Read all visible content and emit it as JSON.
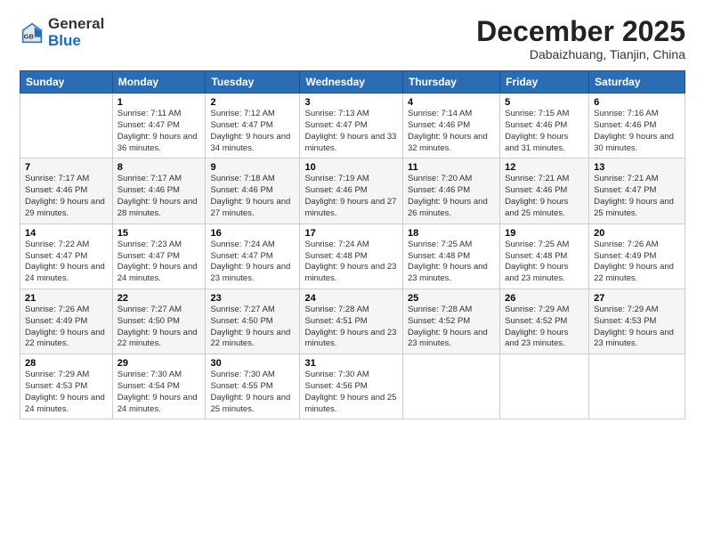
{
  "logo": {
    "text_general": "General",
    "text_blue": "Blue"
  },
  "title": "December 2025",
  "subtitle": "Dabaizhuang, Tianjin, China",
  "days_of_week": [
    "Sunday",
    "Monday",
    "Tuesday",
    "Wednesday",
    "Thursday",
    "Friday",
    "Saturday"
  ],
  "weeks": [
    [
      {
        "day": "",
        "sunrise": "",
        "sunset": "",
        "daylight": ""
      },
      {
        "day": "1",
        "sunrise": "Sunrise: 7:11 AM",
        "sunset": "Sunset: 4:47 PM",
        "daylight": "Daylight: 9 hours and 36 minutes."
      },
      {
        "day": "2",
        "sunrise": "Sunrise: 7:12 AM",
        "sunset": "Sunset: 4:47 PM",
        "daylight": "Daylight: 9 hours and 34 minutes."
      },
      {
        "day": "3",
        "sunrise": "Sunrise: 7:13 AM",
        "sunset": "Sunset: 4:47 PM",
        "daylight": "Daylight: 9 hours and 33 minutes."
      },
      {
        "day": "4",
        "sunrise": "Sunrise: 7:14 AM",
        "sunset": "Sunset: 4:46 PM",
        "daylight": "Daylight: 9 hours and 32 minutes."
      },
      {
        "day": "5",
        "sunrise": "Sunrise: 7:15 AM",
        "sunset": "Sunset: 4:46 PM",
        "daylight": "Daylight: 9 hours and 31 minutes."
      },
      {
        "day": "6",
        "sunrise": "Sunrise: 7:16 AM",
        "sunset": "Sunset: 4:46 PM",
        "daylight": "Daylight: 9 hours and 30 minutes."
      }
    ],
    [
      {
        "day": "7",
        "sunrise": "Sunrise: 7:17 AM",
        "sunset": "Sunset: 4:46 PM",
        "daylight": "Daylight: 9 hours and 29 minutes."
      },
      {
        "day": "8",
        "sunrise": "Sunrise: 7:17 AM",
        "sunset": "Sunset: 4:46 PM",
        "daylight": "Daylight: 9 hours and 28 minutes."
      },
      {
        "day": "9",
        "sunrise": "Sunrise: 7:18 AM",
        "sunset": "Sunset: 4:46 PM",
        "daylight": "Daylight: 9 hours and 27 minutes."
      },
      {
        "day": "10",
        "sunrise": "Sunrise: 7:19 AM",
        "sunset": "Sunset: 4:46 PM",
        "daylight": "Daylight: 9 hours and 27 minutes."
      },
      {
        "day": "11",
        "sunrise": "Sunrise: 7:20 AM",
        "sunset": "Sunset: 4:46 PM",
        "daylight": "Daylight: 9 hours and 26 minutes."
      },
      {
        "day": "12",
        "sunrise": "Sunrise: 7:21 AM",
        "sunset": "Sunset: 4:46 PM",
        "daylight": "Daylight: 9 hours and 25 minutes."
      },
      {
        "day": "13",
        "sunrise": "Sunrise: 7:21 AM",
        "sunset": "Sunset: 4:47 PM",
        "daylight": "Daylight: 9 hours and 25 minutes."
      }
    ],
    [
      {
        "day": "14",
        "sunrise": "Sunrise: 7:22 AM",
        "sunset": "Sunset: 4:47 PM",
        "daylight": "Daylight: 9 hours and 24 minutes."
      },
      {
        "day": "15",
        "sunrise": "Sunrise: 7:23 AM",
        "sunset": "Sunset: 4:47 PM",
        "daylight": "Daylight: 9 hours and 24 minutes."
      },
      {
        "day": "16",
        "sunrise": "Sunrise: 7:24 AM",
        "sunset": "Sunset: 4:47 PM",
        "daylight": "Daylight: 9 hours and 23 minutes."
      },
      {
        "day": "17",
        "sunrise": "Sunrise: 7:24 AM",
        "sunset": "Sunset: 4:48 PM",
        "daylight": "Daylight: 9 hours and 23 minutes."
      },
      {
        "day": "18",
        "sunrise": "Sunrise: 7:25 AM",
        "sunset": "Sunset: 4:48 PM",
        "daylight": "Daylight: 9 hours and 23 minutes."
      },
      {
        "day": "19",
        "sunrise": "Sunrise: 7:25 AM",
        "sunset": "Sunset: 4:48 PM",
        "daylight": "Daylight: 9 hours and 23 minutes."
      },
      {
        "day": "20",
        "sunrise": "Sunrise: 7:26 AM",
        "sunset": "Sunset: 4:49 PM",
        "daylight": "Daylight: 9 hours and 22 minutes."
      }
    ],
    [
      {
        "day": "21",
        "sunrise": "Sunrise: 7:26 AM",
        "sunset": "Sunset: 4:49 PM",
        "daylight": "Daylight: 9 hours and 22 minutes."
      },
      {
        "day": "22",
        "sunrise": "Sunrise: 7:27 AM",
        "sunset": "Sunset: 4:50 PM",
        "daylight": "Daylight: 9 hours and 22 minutes."
      },
      {
        "day": "23",
        "sunrise": "Sunrise: 7:27 AM",
        "sunset": "Sunset: 4:50 PM",
        "daylight": "Daylight: 9 hours and 22 minutes."
      },
      {
        "day": "24",
        "sunrise": "Sunrise: 7:28 AM",
        "sunset": "Sunset: 4:51 PM",
        "daylight": "Daylight: 9 hours and 23 minutes."
      },
      {
        "day": "25",
        "sunrise": "Sunrise: 7:28 AM",
        "sunset": "Sunset: 4:52 PM",
        "daylight": "Daylight: 9 hours and 23 minutes."
      },
      {
        "day": "26",
        "sunrise": "Sunrise: 7:29 AM",
        "sunset": "Sunset: 4:52 PM",
        "daylight": "Daylight: 9 hours and 23 minutes."
      },
      {
        "day": "27",
        "sunrise": "Sunrise: 7:29 AM",
        "sunset": "Sunset: 4:53 PM",
        "daylight": "Daylight: 9 hours and 23 minutes."
      }
    ],
    [
      {
        "day": "28",
        "sunrise": "Sunrise: 7:29 AM",
        "sunset": "Sunset: 4:53 PM",
        "daylight": "Daylight: 9 hours and 24 minutes."
      },
      {
        "day": "29",
        "sunrise": "Sunrise: 7:30 AM",
        "sunset": "Sunset: 4:54 PM",
        "daylight": "Daylight: 9 hours and 24 minutes."
      },
      {
        "day": "30",
        "sunrise": "Sunrise: 7:30 AM",
        "sunset": "Sunset: 4:55 PM",
        "daylight": "Daylight: 9 hours and 25 minutes."
      },
      {
        "day": "31",
        "sunrise": "Sunrise: 7:30 AM",
        "sunset": "Sunset: 4:56 PM",
        "daylight": "Daylight: 9 hours and 25 minutes."
      },
      {
        "day": "",
        "sunrise": "",
        "sunset": "",
        "daylight": ""
      },
      {
        "day": "",
        "sunrise": "",
        "sunset": "",
        "daylight": ""
      },
      {
        "day": "",
        "sunrise": "",
        "sunset": "",
        "daylight": ""
      }
    ]
  ]
}
